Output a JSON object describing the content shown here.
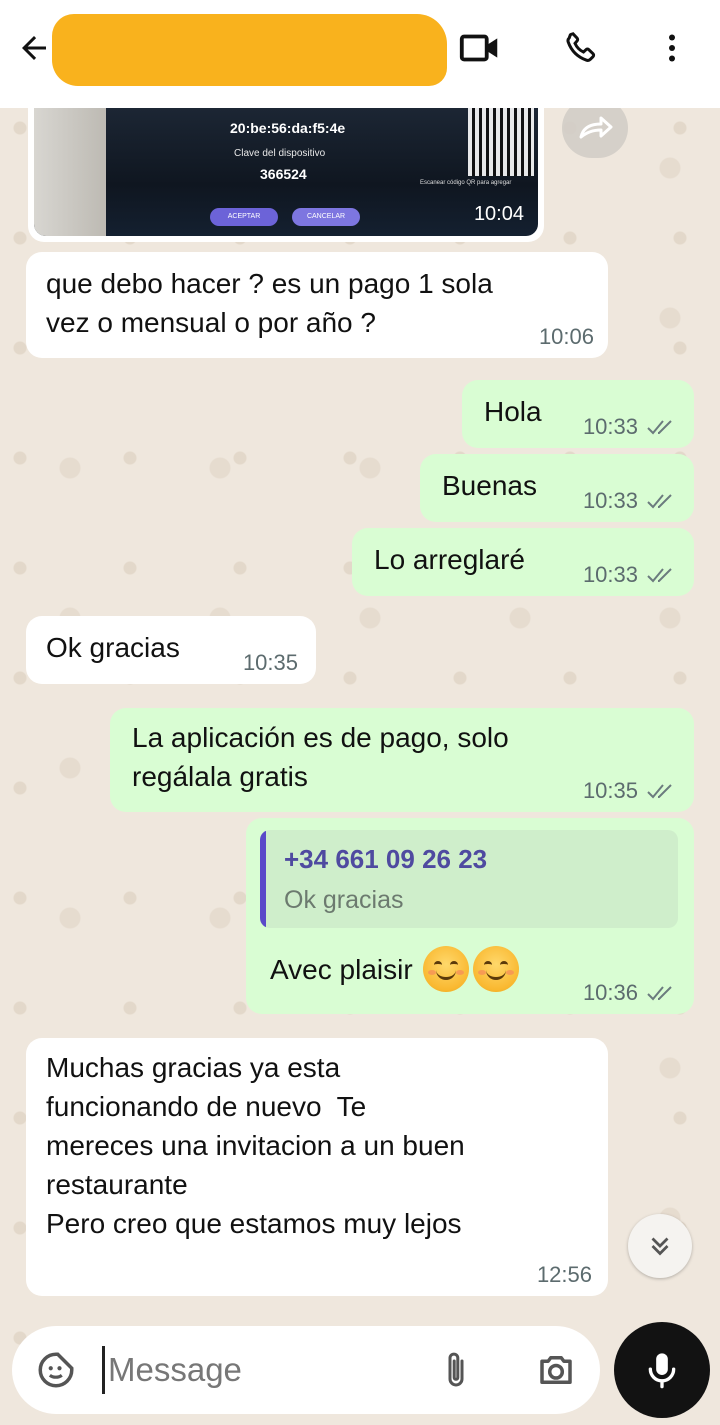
{
  "header": {
    "contact_name": "",
    "icons": [
      "back-arrow-icon",
      "video-call-icon",
      "voice-call-icon",
      "more-vert-icon"
    ]
  },
  "image_message": {
    "mac_text": "20:be:56:da:f5:4e",
    "device_key_label": "Clave del dispositivo",
    "device_key": "366524",
    "button_1": "ACEPTAR",
    "button_2": "CANCELAR",
    "qr_caption": "Escanear código QR para agregar",
    "time": "10:04"
  },
  "messages": [
    {
      "direction": "in",
      "text": "que debo hacer ? es un pago 1 sola\nvez o mensual o por año ?",
      "time": "10:06"
    },
    {
      "direction": "out",
      "text": "Hola",
      "time": "10:33"
    },
    {
      "direction": "out",
      "text": "Buenas",
      "time": "10:33"
    },
    {
      "direction": "out",
      "text": "Lo arreglaré",
      "time": "10:33"
    },
    {
      "direction": "in",
      "text": "Ok gracias",
      "time": "10:35"
    },
    {
      "direction": "out",
      "text": "La aplicación es de pago, solo\nregálala gratis",
      "time": "10:35"
    },
    {
      "direction": "out",
      "text": "Avec plaisir",
      "time": "10:36",
      "quote": {
        "sender": "+34 661 09 26 23",
        "text": "Ok gracias"
      },
      "emoji": [
        "smiling-face-emoji",
        "smiling-face-emoji"
      ]
    },
    {
      "direction": "in",
      "text": "Muchas gracias ya esta\nfuncionando de nuevo  Te\nmereces una invitacion a un buen\nrestaurante\nPero creo que estamos muy lejos",
      "time": "12:56"
    }
  ],
  "input": {
    "placeholder": "Message"
  },
  "colors": {
    "outgoing_bubble": "#d9fdd3",
    "incoming_bubble": "#ffffff",
    "wallpaper": "#efe7dd",
    "quote_bar": "#5a49c9",
    "name_redaction": "#f9b21d"
  }
}
